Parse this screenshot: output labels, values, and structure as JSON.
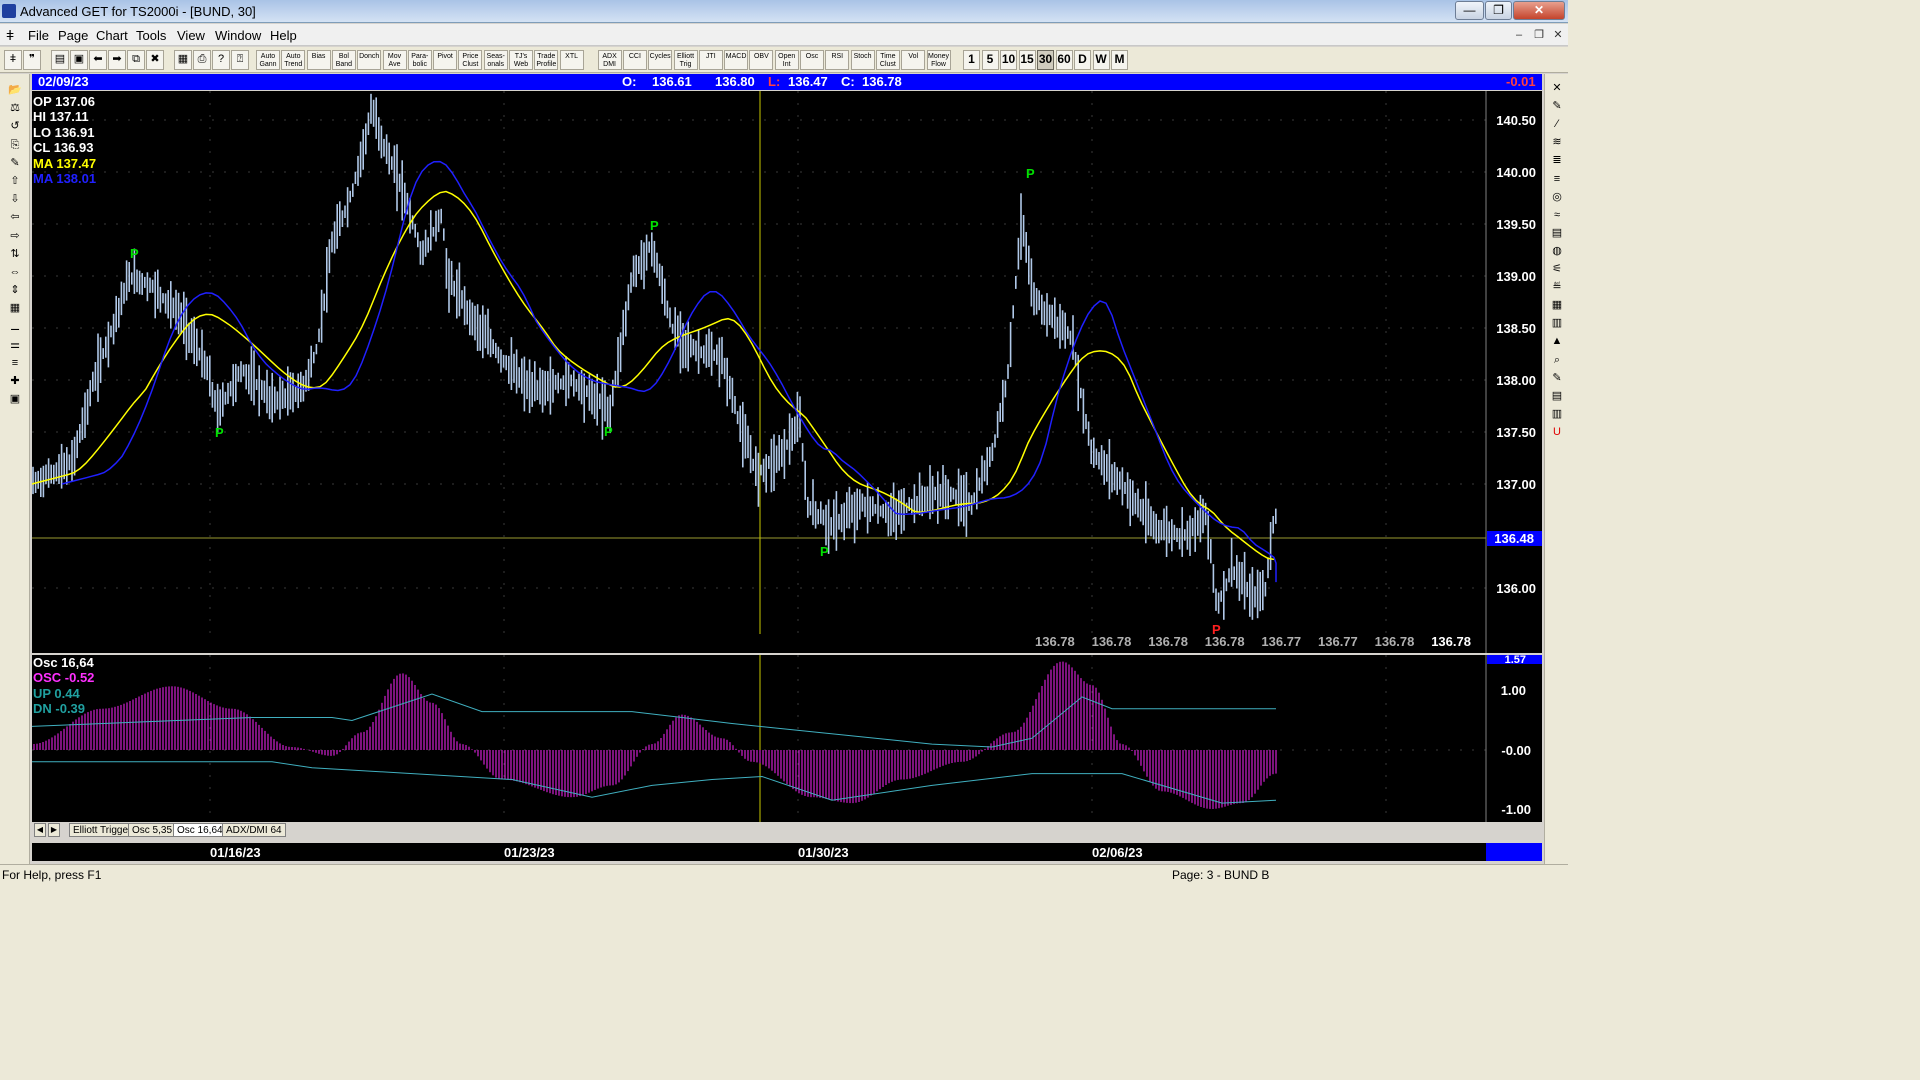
{
  "window": {
    "title": "Advanced GET for TS2000i - [BUND, 30]",
    "minimize": "—",
    "maximize": "❐",
    "close": "✕"
  },
  "menu": {
    "items": [
      "File",
      "Page",
      "Chart",
      "Tools",
      "View",
      "Window",
      "Help"
    ]
  },
  "toolbar": {
    "icon_buttons": [
      "ǂ",
      "❞",
      "▤",
      "▣",
      "⬅",
      "➡",
      "⧉",
      "✖",
      "▦",
      "⎙",
      "?",
      "⍰"
    ],
    "study_buttons": [
      "Auto Gann",
      "Auto Trend",
      "Bias",
      "Bol Band",
      "Donch",
      "Mov Ave",
      "Para- bolic",
      "Pivot",
      "Price Clust",
      "Seas- onals",
      "TJ's Web",
      "Trade Profile",
      "XTL",
      "ADX DMI",
      "CCI",
      "Cycles",
      "Elliott Trig",
      "JTI",
      "MACD",
      "OBV",
      "Open Int",
      "Osc",
      "RSI",
      "Stoch",
      "Time Clust",
      "Vol",
      "Money Flow"
    ],
    "periods": [
      "1",
      "5",
      "10",
      "15",
      "30",
      "60",
      "D",
      "W",
      "M"
    ],
    "active_period": "30"
  },
  "header": {
    "date": "02/09/23",
    "open_label": "O:",
    "open": "136.61",
    "high": "136.80",
    "low_label": "L:",
    "low": "136.47",
    "close_label": "C:",
    "close": "136.78",
    "change": "-0.01"
  },
  "legend": {
    "op": "OP  137.06",
    "hi": "HI   137.11",
    "lo": "LO   136.91",
    "cl": "CL   136.93",
    "ma1": "MA  137.47",
    "ma2": "MA  138.01"
  },
  "price_axis": {
    "ticks": [
      "140.50",
      "140.00",
      "139.50",
      "139.00",
      "138.50",
      "138.00",
      "137.50",
      "137.00",
      "136.00"
    ],
    "current_price": "136.48"
  },
  "bottom_readouts": [
    "136.78",
    "136.78",
    "136.78",
    "136.78",
    "136.77",
    "136.77",
    "136.78",
    "136.78"
  ],
  "oscillator": {
    "title": "Osc 16,64",
    "osc_label": "OSC -0.52",
    "up_label": "UP   0.44",
    "dn_label": "DN   -0.39",
    "axis": [
      "1.57",
      "1.00",
      "-0.00",
      "-1.00"
    ]
  },
  "osc_tabs": [
    "Elliott Trigger",
    "Osc 5,35",
    "Osc 16,64",
    "ADX/DMI 64"
  ],
  "active_osc_tab": "Osc 16,64",
  "dates": [
    "01/16/23",
    "01/23/23",
    "01/30/23",
    "02/06/23"
  ],
  "status": {
    "help": "For Help, press F1",
    "page": "Page: 3 - BUND B"
  },
  "pivots": {
    "label": "P"
  },
  "colors": {
    "header_blue": "#0000ff",
    "bar": "#b0c8e8",
    "ma_yellow": "#ffff00",
    "ma_blue": "#2020ff",
    "pivot_green": "#00e000",
    "pivot_red": "#ff2020",
    "osc_magenta": "#d020d0",
    "band_cyan": "#40b0c0"
  }
}
